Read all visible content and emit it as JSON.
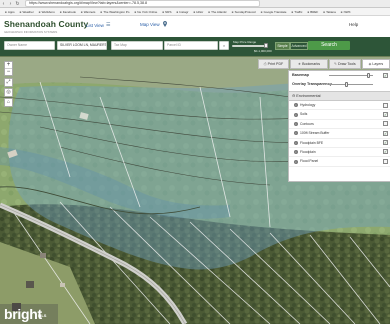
{
  "browser": {
    "url": "https://www.shenandoahgis.org/#/mapView?tab=layers&center=-78.5,38.8",
    "bookmarks": [
      "Apps",
      "Weather",
      "Wellsboro",
      "Facebook",
      "Wannets",
      "The Washington Po",
      "Ne York Online",
      "NRS",
      "Instagr",
      "Hiltor",
      "The Atlantic",
      "SundayProtocol",
      "Google Translate",
      "Traffic",
      "BREF",
      "Tatiana",
      "NWK"
    ]
  },
  "header": {
    "title": "Shenandoah County",
    "tagline": "GEOGRAPHIC INFORMATION SYSTEMS",
    "list_view": "List View",
    "map_view": "Map View",
    "help": "Help"
  },
  "search": {
    "owner_placeholder": "Owner Name",
    "address_value": "SILVER LOOM LN, MAURERTOWN",
    "map_placeholder": "Tax Map",
    "parcel_placeholder": "Parcel ID",
    "range_label": "Map Price Range",
    "range_value": "$0-1,000,000",
    "simple_label": "Simple",
    "advanced_label": "Advanced",
    "button_label": "Search"
  },
  "map_controls": {
    "zoom_in": "+",
    "zoom_out": "−"
  },
  "panel": {
    "tabs": [
      "Print PDF",
      "Bookmarks",
      "Draw Tools",
      "Layers"
    ],
    "active_tab": "Layers",
    "basemap_label": "Basemap",
    "basemap_value": 0.9,
    "overlay_label": "Overlay Transparency",
    "overlay_value": 0.4,
    "section": "Environmental",
    "layers": [
      {
        "name": "Hydrology",
        "checked": false
      },
      {
        "name": "Soils",
        "checked": true
      },
      {
        "name": "Contours",
        "checked": false
      },
      {
        "name": "100ft Stream Buffer",
        "checked": true
      },
      {
        "name": "Floodplain BFE",
        "checked": true
      },
      {
        "name": "Floodplain",
        "checked": true
      },
      {
        "name": "Flood Panel",
        "checked": false
      }
    ]
  },
  "watermark": {
    "logo": "bright",
    "tag": "MLS"
  },
  "colors": {
    "header_green": "#2d5538",
    "search_button": "#4d9a48",
    "title_green": "#2d4e2c",
    "link_blue": "#2a5fa8"
  }
}
